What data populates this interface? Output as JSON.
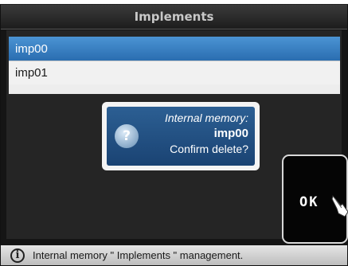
{
  "header": {
    "title": "Implements"
  },
  "list": {
    "items": [
      {
        "label": "imp00",
        "selected": true
      },
      {
        "label": "imp01",
        "selected": false
      }
    ]
  },
  "dialog": {
    "line1": "Internal memory:",
    "line2": "imp00",
    "line3": "Confirm delete?",
    "icon": "question-icon"
  },
  "buttons": {
    "ok_label": "OK"
  },
  "status": {
    "text": "Internal memory \" Implements \" management.",
    "icon": "info-icon"
  },
  "colors": {
    "selection": "#3b83c6",
    "dialog": "#1f4f84",
    "background": "#151515"
  }
}
